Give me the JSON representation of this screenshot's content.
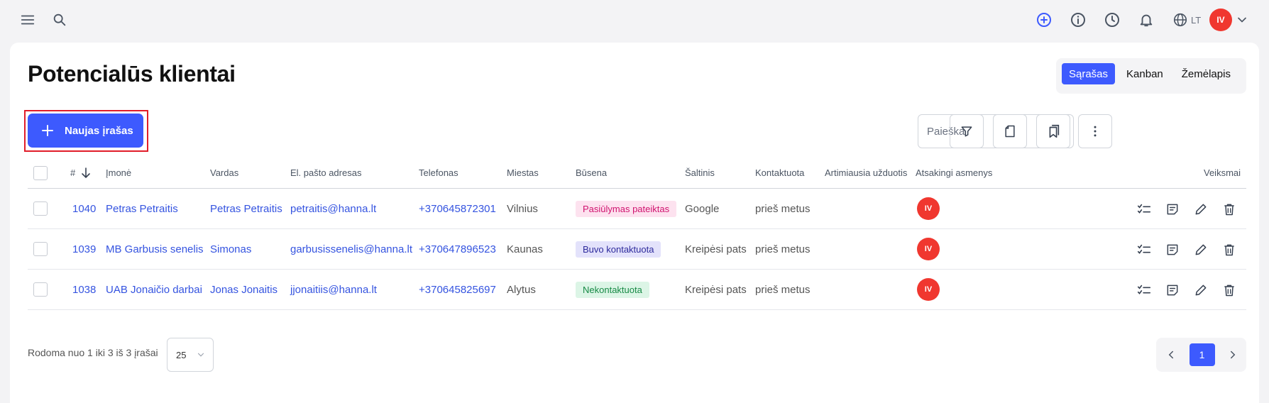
{
  "header": {
    "icons": [
      "menu-icon",
      "search-icon",
      "add-circle-icon",
      "info-icon",
      "clock-icon",
      "bell-icon",
      "globe-icon"
    ],
    "language": "LT",
    "user_initials": "IV",
    "accent_color": "#3d5afe",
    "avatar_color": "#f0372f"
  },
  "page": {
    "title": "Potencialūs klientai",
    "views": [
      "Sąrašas",
      "Kanban",
      "Žemėlapis"
    ],
    "active_view": "Sąrašas",
    "new_button_label": "Naujas įrašas",
    "search_placeholder": "Paieška"
  },
  "table": {
    "headers": {
      "id": "#",
      "company": "Įmonė",
      "name": "Vardas",
      "email": "El. pašto adresas",
      "phone": "Telefonas",
      "city": "Miestas",
      "status": "Būsena",
      "source": "Šaltinis",
      "contacted": "Kontaktuota",
      "next_task": "Artimiausia užduotis",
      "owners": "Atsakingi asmenys",
      "actions": "Veiksmai"
    },
    "rows": [
      {
        "id": "1040",
        "company": "Petras Petraitis",
        "name": "Petras Petraitis",
        "email": "petraitis@hanna.lt",
        "phone": "+370645872301",
        "city": "Vilnius",
        "status": "Pasiūlymas pateiktas",
        "status_color": "#d0136f",
        "source": "Google",
        "contacted": "prieš metus",
        "owner": "IV"
      },
      {
        "id": "1039",
        "company": "MB Garbusis senelis",
        "name": "Simonas",
        "email": "garbusissenelis@hanna.lt",
        "phone": "+370647896523",
        "city": "Kaunas",
        "status": "Buvo kontaktuota",
        "status_color": "#2d2a9c",
        "source": "Kreipėsi pats",
        "contacted": "prieš metus",
        "owner": "IV"
      },
      {
        "id": "1038",
        "company": "UAB Jonaičio darbai",
        "name": "Jonas Jonaitis",
        "email": "jjonaitiis@hanna.lt",
        "phone": "+370645825697",
        "city": "Alytus",
        "status": "Nekontaktuota",
        "status_color": "#178a45",
        "source": "Kreipėsi pats",
        "contacted": "prieš metus",
        "owner": "IV"
      }
    ]
  },
  "footer": {
    "summary": "Rodoma nuo 1 iki 3 iš 3 įrašai",
    "page_size": "25",
    "current_page": "1"
  }
}
